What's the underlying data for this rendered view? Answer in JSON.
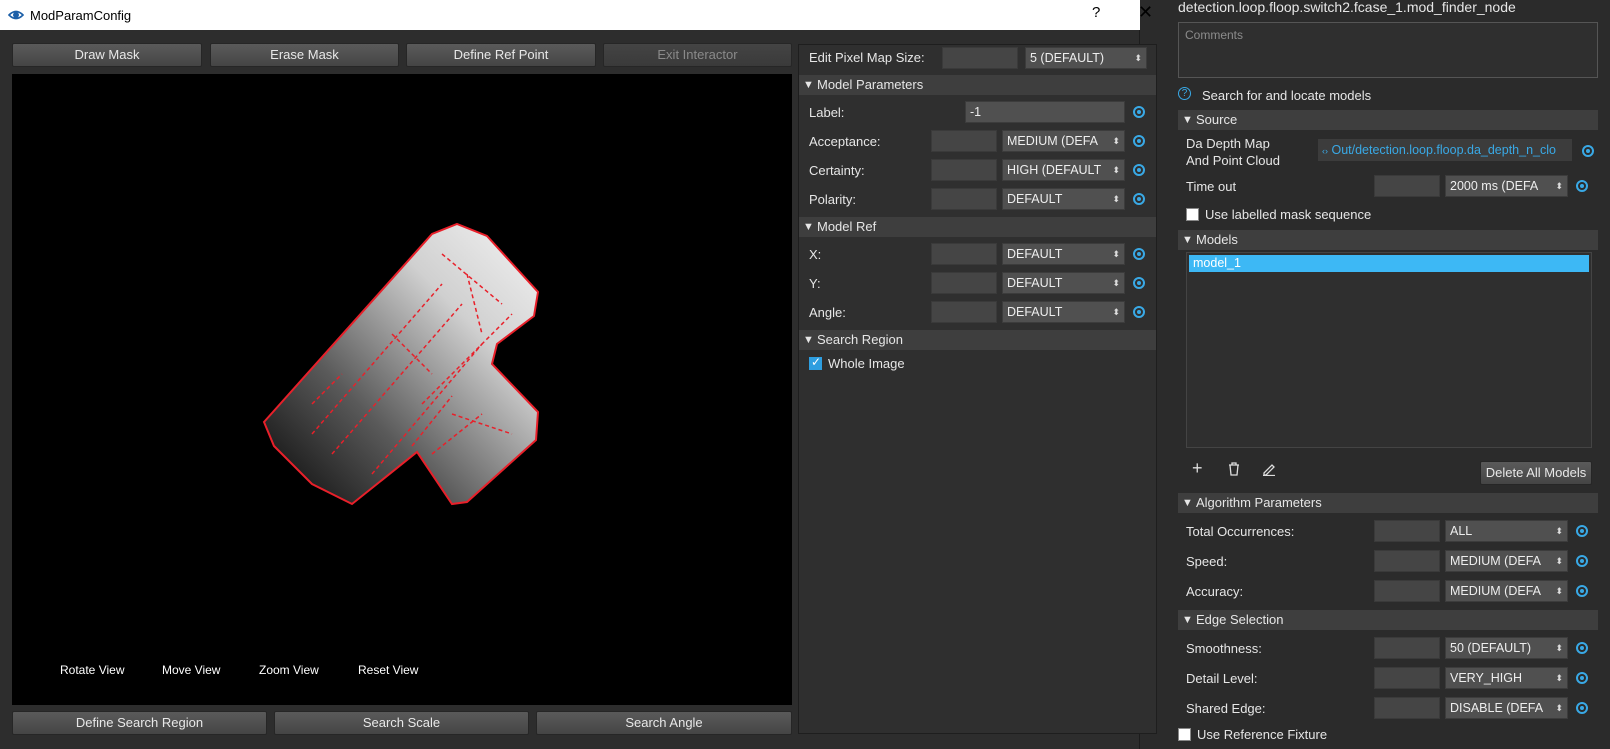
{
  "window": {
    "title": "ModParamConfig",
    "help": "?",
    "close": "✕"
  },
  "toolbar": {
    "draw_mask": "Draw Mask",
    "erase_mask": "Erase Mask",
    "define_ref_point": "Define Ref Point",
    "exit_interactor": "Exit Interactor"
  },
  "viewer": {
    "rotate": "Rotate View",
    "move": "Move View",
    "zoom": "Zoom View",
    "reset": "Reset View"
  },
  "bottom": {
    "define_search_region": "Define Search Region",
    "search_scale": "Search Scale",
    "search_angle": "Search Angle"
  },
  "params": {
    "pixel_map_label": "Edit Pixel Map Size:",
    "pixel_map_value": "5 (DEFAULT)",
    "model_parameters": {
      "title": "Model Parameters",
      "label_label": "Label:",
      "label_value": "-1",
      "acceptance_label": "Acceptance:",
      "acceptance_value": "MEDIUM (DEFA",
      "certainty_label": "Certainty:",
      "certainty_value": "HIGH (DEFAULT",
      "polarity_label": "Polarity:",
      "polarity_value": "DEFAULT"
    },
    "model_ref": {
      "title": "Model Ref",
      "x_label": "X:",
      "x_value": "DEFAULT",
      "y_label": "Y:",
      "y_value": "DEFAULT",
      "angle_label": "Angle:",
      "angle_value": "DEFAULT"
    },
    "search_region": {
      "title": "Search Region",
      "whole_image": "Whole Image"
    }
  },
  "right": {
    "node_path": "detection.loop.floop.switch2.fcase_1.mod_finder_node",
    "comments_placeholder": "Comments",
    "description": "Search for and locate models",
    "source": {
      "title": "Source",
      "depth_label_1": "Da Depth Map",
      "depth_label_2": "And Point Cloud",
      "depth_value": "Out/detection.loop.floop.da_depth_n_clo",
      "timeout_label": "Time out",
      "timeout_value": "2000 ms (DEFA",
      "labelled_mask": "Use labelled mask sequence"
    },
    "models": {
      "title": "Models",
      "items": [
        "model_1"
      ],
      "delete_all": "Delete All Models"
    },
    "algorithm": {
      "title": "Algorithm Parameters",
      "occurrences_label": "Total Occurrences:",
      "occurrences_value": "ALL",
      "speed_label": "Speed:",
      "speed_value": "MEDIUM (DEFA",
      "accuracy_label": "Accuracy:",
      "accuracy_value": "MEDIUM (DEFA"
    },
    "edge": {
      "title": "Edge Selection",
      "smoothness_label": "Smoothness:",
      "smoothness_value": "50 (DEFAULT)",
      "detail_label": "Detail Level:",
      "detail_value": "VERY_HIGH",
      "shared_label": "Shared Edge:",
      "shared_value": "DISABLE (DEFA",
      "reference_fixture": "Use Reference Fixture"
    }
  },
  "colors": {
    "accent": "#39a9e6",
    "selection": "#3db8f5",
    "edge": "#e8202a"
  }
}
